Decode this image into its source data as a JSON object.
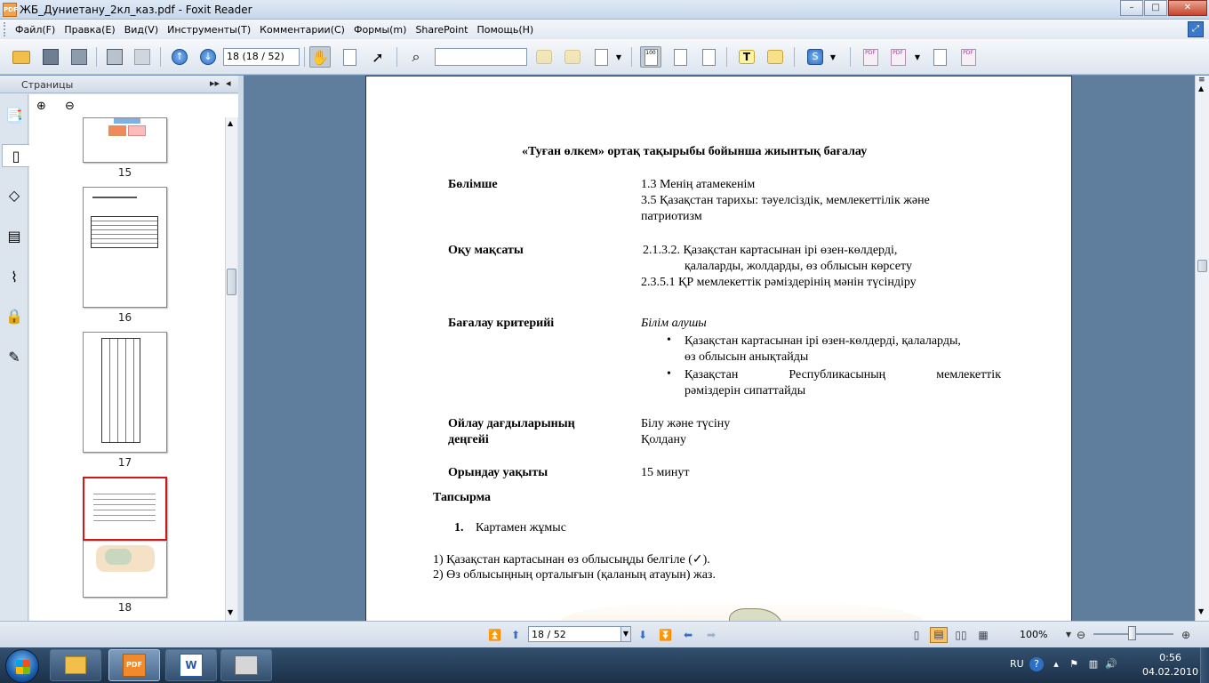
{
  "window": {
    "title": "ЖБ_Дуниетану_2кл_каз.pdf - Foxit Reader",
    "app_icon_label": "PDF",
    "minimize": "–",
    "maximize": "□",
    "close": "✕"
  },
  "menu": {
    "items": [
      "Файл(F)",
      "Правка(E)",
      "Вид(V)",
      "Инструменты(T)",
      "Комментарии(C)",
      "Формы(m)",
      "SharePoint",
      "Помощь(H)"
    ]
  },
  "toolbar": {
    "page_field": "18 (18 / 52)",
    "search_value": "",
    "up_glyph": "↑",
    "down_glyph": "↓"
  },
  "left_pane": {
    "header": "Страницы",
    "expand_glyph": "▸▸",
    "collapse_glyph": "◂",
    "thumbnails": [
      {
        "number": "15"
      },
      {
        "number": "16"
      },
      {
        "number": "17"
      },
      {
        "number": "18"
      }
    ]
  },
  "document": {
    "heading": "«Туған өлкем» ортақ тақырыбы бойынша жиынтық бағалау",
    "rows": [
      {
        "label": "Бөлімше",
        "lines": [
          "1.3 Менің атамекенім",
          "3.5 Қазақстан тарихы: тәуелсіздік, мемлекеттілік және",
          "патриотизм"
        ]
      },
      {
        "label": "Оқу мақсаты",
        "lines": [
          "2.1.3.2. Қазақстан картасынан ірі өзен-көлдерді,",
          "қалаларды, жолдарды, өз облысын көрсету",
          "2.3.5.1 ҚР мемлекеттік рәміздерінің мәнін түсіндіру"
        ]
      },
      {
        "label": "Бағалау критерийі",
        "lead": "Білім алушы",
        "bullets": [
          "Қазақстан картасынан ірі өзен-көлдерді, қалаларды,",
          "өз облысын анықтайды",
          "Қазақстан Республикасының мемлекеттік",
          "рәміздерін сипаттайды"
        ]
      },
      {
        "label_lines": [
          "Ойлау дағдыларының",
          "деңгейі"
        ],
        "lines": [
          "Білу және түсіну",
          "Қолдану"
        ]
      },
      {
        "label": "Орындау уақыты",
        "lines": [
          "15 минут"
        ]
      }
    ],
    "task_heading": "Тапсырма",
    "task_item_number": "1.",
    "task_item": "Картамен жұмыс",
    "instructions": [
      "1) Қазақстан картасынан өз облысыңды белгіле (✓).",
      "2) Өз облысыңның орталығын (қаланың атауын) жаз."
    ]
  },
  "statusbar": {
    "page_field": "18 / 52",
    "zoom": "100%"
  },
  "taskbar": {
    "pdf_label": "PDF",
    "word_label": "W",
    "lang": "RU",
    "time": "0:56",
    "date": "04.02.2010"
  }
}
